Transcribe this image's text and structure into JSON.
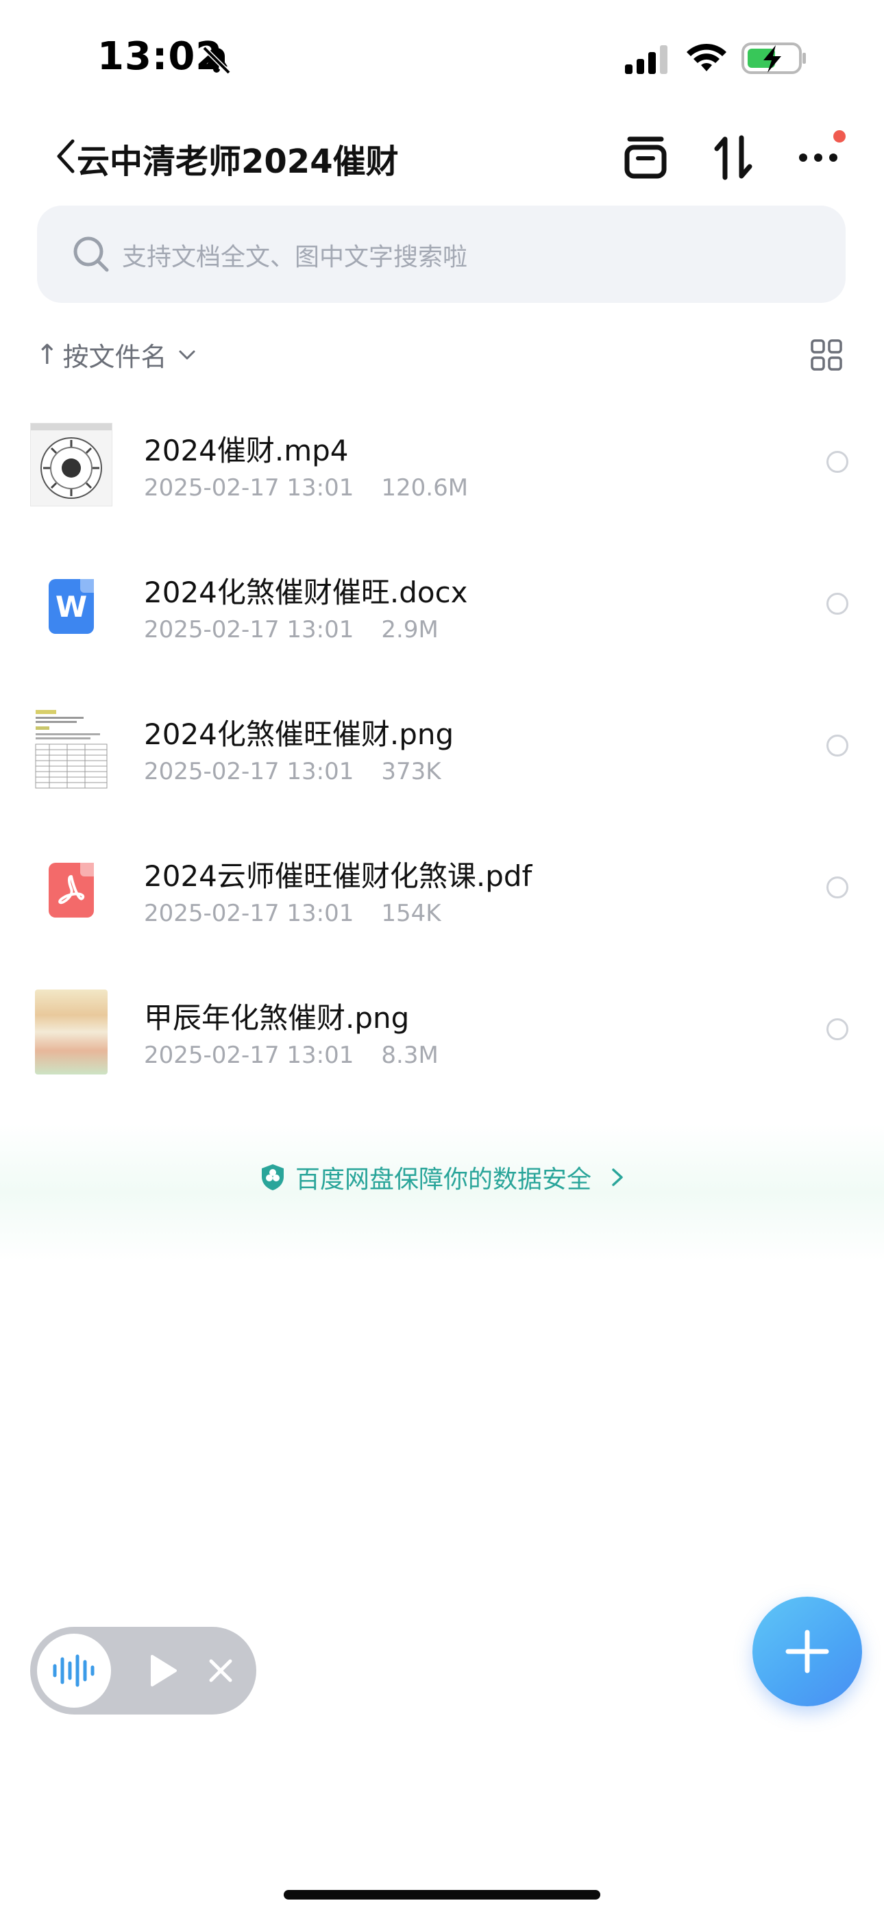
{
  "status_bar": {
    "time": "13:02",
    "icons": [
      "bell-slash-icon",
      "signal-icon",
      "wifi-icon",
      "battery-charging-icon"
    ]
  },
  "header": {
    "title": "云中清老师2024催财",
    "icons": [
      "back-icon",
      "trash-icon",
      "sort-icon",
      "more-icon"
    ]
  },
  "search": {
    "placeholder": "支持文档全文、图中文字搜索啦"
  },
  "sort": {
    "label": "按文件名",
    "arrow": "↑"
  },
  "files": [
    {
      "name": "2024催财.mp4",
      "date": "2025-02-17 13:01",
      "size": "120.6M",
      "type": "video"
    },
    {
      "name": "2024化煞催财催旺.docx",
      "date": "2025-02-17 13:01",
      "size": "2.9M",
      "type": "docx",
      "icon_letter": "W"
    },
    {
      "name": "2024化煞催旺催财.png",
      "date": "2025-02-17 13:01",
      "size": "373K",
      "type": "image-table"
    },
    {
      "name": "2024云师催旺催财化煞课.pdf",
      "date": "2025-02-17 13:01",
      "size": "154K",
      "type": "pdf"
    },
    {
      "name": "甲辰年化煞催财.png",
      "date": "2025-02-17 13:01",
      "size": "8.3M",
      "type": "image-photo"
    }
  ],
  "security": {
    "text": "百度网盘保障你的数据安全",
    "color": "#2aa59a"
  },
  "colors": {
    "accent": "#4ba5f5",
    "notification_dot": "#f05a4f",
    "pdf": "#f36a6a",
    "docx": "#3d86f0"
  }
}
